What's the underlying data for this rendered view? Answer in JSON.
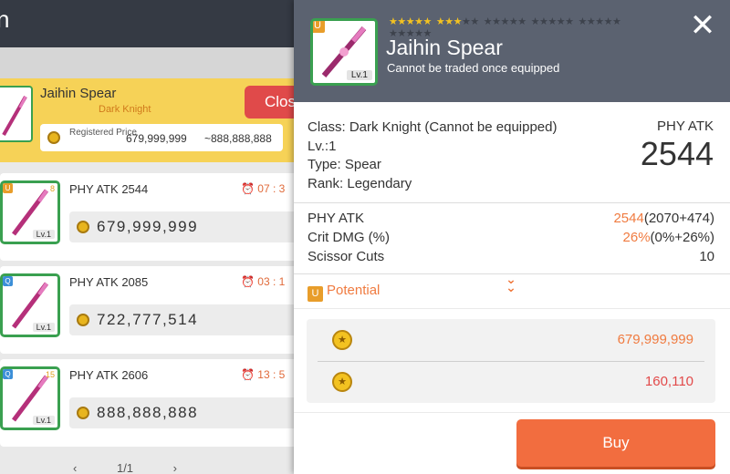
{
  "background": {
    "title_fragment": "n",
    "registered": {
      "item_name": "Jaihin Spear",
      "class_hint": "Dark Knight",
      "close_label": "Clos",
      "price_label": "Registered Price",
      "price_value": "679,999,999",
      "price_max": "~888,888,888"
    },
    "listings": [
      {
        "atk": "PHY ATK 2544",
        "time": "07 : 3",
        "price": "679,999,999",
        "lv": "Lv.1",
        "badge": "U",
        "badge_color": "#e89d2a",
        "star": "8"
      },
      {
        "atk": "PHY ATK 2085",
        "time": "03 : 1",
        "price": "722,777,514",
        "lv": "Lv.1",
        "badge": "Q",
        "badge_color": "#3b8fd8",
        "star": ""
      },
      {
        "atk": "PHY ATK 2606",
        "time": "13 : 5",
        "price": "888,888,888",
        "lv": "Lv.1",
        "badge": "Q",
        "badge_color": "#3b8fd8",
        "star": "15"
      }
    ],
    "pager": "1/1"
  },
  "panel": {
    "rank_badge": "U",
    "level": "Lv.1",
    "stars": {
      "filled": 8,
      "total": 30
    },
    "item_name": "Jaihin Spear",
    "trade_note": "Cannot be traded once equipped",
    "info_lines": [
      "Class: Dark Knight (Cannot be equipped)",
      "Lv.:1",
      "Type: Spear",
      "Rank: Legendary"
    ],
    "main_stat_label": "PHY ATK",
    "main_stat_value": "2544",
    "stats": [
      {
        "label": "PHY ATK",
        "value": "2544",
        "detail": "(2070+474)"
      },
      {
        "label": "Crit DMG (%)",
        "value": "26%",
        "detail": "(0%+26%)"
      },
      {
        "label": "Scissor Cuts",
        "value": "",
        "detail": "10"
      }
    ],
    "potential_label": "Potential",
    "prices": [
      {
        "value": "679,999,999",
        "color": "#f07b40"
      },
      {
        "value": "160,110",
        "color": "#e24a4a"
      }
    ],
    "buy_label": "Buy"
  },
  "colors": {
    "accent": "#f26d3f",
    "rank_green": "#3aa050",
    "header": "#5b6270"
  }
}
